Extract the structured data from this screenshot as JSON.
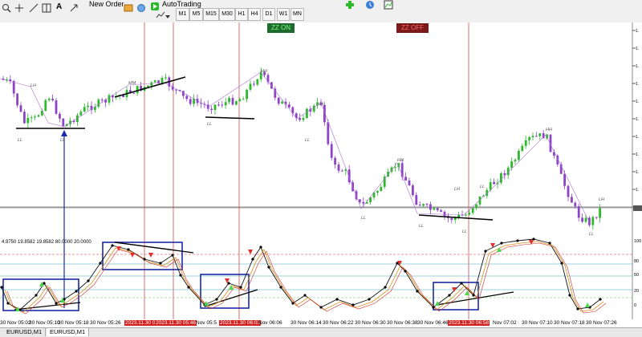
{
  "toolbar": {
    "new_order_label": "New Order",
    "autotrading_label": "AutoTrading",
    "timeframes": [
      "M1",
      "M5",
      "M15",
      "M30",
      "H1",
      "H4",
      "D1",
      "W1",
      "MN"
    ]
  },
  "chart": {
    "zz_on_label": "ZZ ON",
    "zz_off_label": "ZZ OFF",
    "oscillator_values": "4.9750 19.8582 19.8582 80.0000 20.0000",
    "labels": [
      "LH",
      "MM",
      "HH",
      "LH",
      "HH",
      "LH",
      "LH",
      "HH",
      "LL",
      "LL",
      "LL",
      "LL",
      "LL",
      "LL",
      "LL",
      "LL",
      "LL"
    ],
    "right_axis_values": [
      "100",
      "80",
      "50",
      "20",
      "0"
    ]
  },
  "time_axis": [
    {
      "label": "30 Nov 05:02",
      "hl": false
    },
    {
      "label": "30 Nov 05:10",
      "hl": false
    },
    {
      "label": "30 Nov 05:18",
      "hl": false
    },
    {
      "label": "30 Nov 05:26",
      "hl": false
    },
    {
      "label": "2023.11.30 05:40",
      "hl": true
    },
    {
      "label": "2023.11.30 05:46",
      "hl": true
    },
    {
      "label": "Nov 05:5",
      "hl": false
    },
    {
      "label": "2023.11.30 06:02",
      "hl": true
    },
    {
      "label": "Nov 06:06",
      "hl": false
    },
    {
      "label": "30 Nov 06:14",
      "hl": false
    },
    {
      "label": "30 Nov 06:22",
      "hl": false
    },
    {
      "label": "30 Nov 06:30",
      "hl": false
    },
    {
      "label": "30 Nov 06:38",
      "hl": false
    },
    {
      "label": "30 Nov 06:46",
      "hl": false
    },
    {
      "label": "2023.11.30 06:58",
      "hl": true
    },
    {
      "label": "Nov 07:02",
      "hl": false
    },
    {
      "label": "30 Nov 07:10",
      "hl": false
    },
    {
      "label": "30 Nov 07:18",
      "hl": false
    },
    {
      "label": "30 Nov 07:26",
      "hl": false
    }
  ],
  "tabs": [
    {
      "label": "EURUSD,M1",
      "active": false
    },
    {
      "label": "EURUSD,M1",
      "active": true
    }
  ],
  "colors": {
    "bull": "#2db82d",
    "bear": "#8e44c9",
    "vline": "#d23030",
    "box": "#1a2aa8",
    "zz": "#aa6fd0",
    "teal": "#3aa7b8",
    "red_dash": "#d03030",
    "green_dash": "#6ac45c"
  }
}
